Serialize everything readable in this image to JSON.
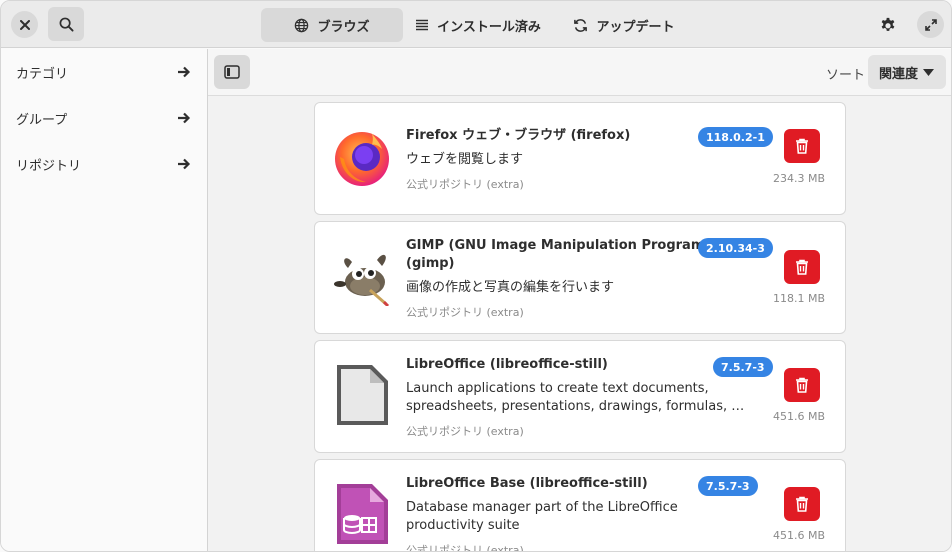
{
  "header": {
    "tabs": [
      {
        "label": "ブラウズ",
        "icon": "globe-icon",
        "active": true
      },
      {
        "label": "インストール済み",
        "icon": "list-icon",
        "active": false
      },
      {
        "label": "アップデート",
        "icon": "refresh-icon",
        "active": false
      }
    ]
  },
  "sidebar": {
    "items": [
      {
        "label": "カテゴリ"
      },
      {
        "label": "グループ"
      },
      {
        "label": "リポジトリ"
      }
    ]
  },
  "toolbar": {
    "sort_label": "ソート",
    "sort_value": "関連度"
  },
  "packages": [
    {
      "title": "Firefox ウェブ・ブラウザ (firefox)",
      "description": "ウェブを閲覧します",
      "repo": "公式リポジトリ (extra)",
      "version": "118.0.2-1",
      "size": "234.3 MB",
      "icon": "firefox-icon"
    },
    {
      "title_line1": "GIMP (GNU Image Manipulation Program)",
      "title_line2": "(gimp)",
      "description": "画像の作成と写真の編集を行います",
      "repo": "公式リポジトリ (extra)",
      "version": "2.10.34-3",
      "size": "118.1 MB",
      "icon": "gimp-icon"
    },
    {
      "title": "LibreOffice (libreoffice-still)",
      "description_line1": "Launch applications to create text documents,",
      "description_line2": "spreadsheets, presentations, drawings, formulas, …",
      "repo": "公式リポジトリ (extra)",
      "version": "7.5.7-3",
      "size": "451.6 MB",
      "icon": "libreoffice-icon"
    },
    {
      "title": "LibreOffice Base (libreoffice-still)",
      "description_line1": "Database manager part of the LibreOffice",
      "description_line2": "productivity suite",
      "repo": "公式リポジトリ (extra)",
      "version": "7.5.7-3",
      "size": "451.6 MB",
      "icon": "libreoffice-base-icon"
    }
  ],
  "colors": {
    "accent": "#3584e4",
    "destructive": "#e01b24"
  }
}
